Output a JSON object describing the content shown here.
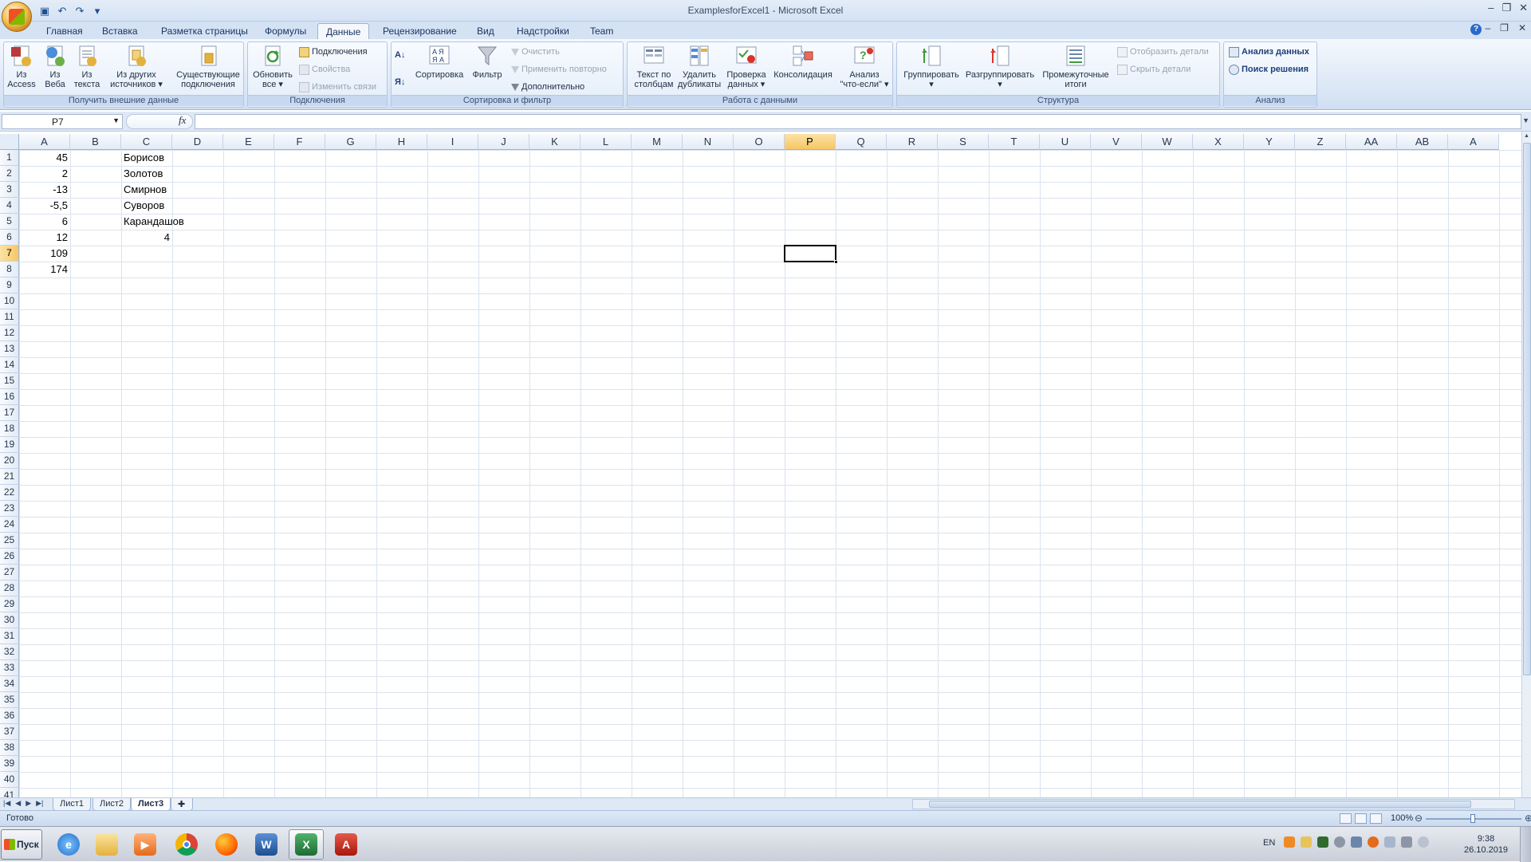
{
  "window": {
    "title": "ExamplesforExcel1 - Microsoft Excel"
  },
  "qat": {
    "icons": [
      "save-icon",
      "undo-icon",
      "redo-icon",
      "customize-icon"
    ]
  },
  "tabs": [
    {
      "label": "Главная"
    },
    {
      "label": "Вставка"
    },
    {
      "label": "Разметка страницы"
    },
    {
      "label": "Формулы"
    },
    {
      "label": "Данные",
      "active": true
    },
    {
      "label": "Рецензирование"
    },
    {
      "label": "Вид"
    },
    {
      "label": "Надстройки"
    },
    {
      "label": "Team"
    }
  ],
  "ribbon": {
    "groups": {
      "external": "Получить внешние данные",
      "connections": "Подключения",
      "sortfilter": "Сортировка и фильтр",
      "datatools": "Работа с данными",
      "outline": "Структура",
      "analysis": "Анализ"
    },
    "external": {
      "access": [
        "Из",
        "Access"
      ],
      "web": [
        "Из",
        "Веба"
      ],
      "text": [
        "Из",
        "текста"
      ],
      "other": [
        "Из других",
        "источников ▾"
      ],
      "existing": [
        "Существующие",
        "подключения"
      ]
    },
    "connections": {
      "refresh": [
        "Обновить",
        "все ▾"
      ],
      "conn": "Подключения",
      "props": "Свойства",
      "edit_links": "Изменить связи"
    },
    "sortfilter": {
      "sort": "Сортировка",
      "filter": "Фильтр",
      "clear": "Очистить",
      "reapply": "Применить повторно",
      "advanced": "Дополнительно"
    },
    "datatools": {
      "text_to_cols": [
        "Текст по",
        "столбцам"
      ],
      "remove_dup": [
        "Удалить",
        "дубликаты"
      ],
      "validation": [
        "Проверка",
        "данных ▾"
      ],
      "consolidate": "Консолидация",
      "whatif": [
        "Анализ",
        "\"что-если\" ▾"
      ]
    },
    "outline": {
      "group": [
        "Группировать",
        "▾"
      ],
      "ungroup": [
        "Разгруппировать",
        "▾"
      ],
      "subtotal": [
        "Промежуточные",
        "итоги"
      ],
      "show": "Отобразить детали",
      "hide": "Скрыть детали"
    },
    "analysis": {
      "data_analysis": "Анализ данных",
      "solver": "Поиск решения"
    }
  },
  "formula_bar": {
    "name_box": "P7",
    "fx": "fx",
    "formula": ""
  },
  "columns": [
    "A",
    "B",
    "C",
    "D",
    "E",
    "F",
    "G",
    "H",
    "I",
    "J",
    "K",
    "L",
    "M",
    "N",
    "O",
    "P",
    "Q",
    "R",
    "S",
    "T",
    "U",
    "V",
    "W",
    "X",
    "Y",
    "Z",
    "AA",
    "AB",
    "A"
  ],
  "selected_column": "P",
  "selected_row": 7,
  "row_count": 41,
  "cells": {
    "A1": "45",
    "A2": "2",
    "A3": "-13",
    "A4": "-5,5",
    "A5": "6",
    "A6": "12",
    "A7": "109",
    "A8": "174",
    "C1": "Борисов",
    "C2": "Золотов",
    "C3": "Смирнов",
    "C4": "Суворов",
    "C5": "Карандашов",
    "C6": "4"
  },
  "sheets": [
    {
      "label": "Лист1"
    },
    {
      "label": "Лист2"
    },
    {
      "label": "Лист3",
      "active": true
    }
  ],
  "status": {
    "text": "Готово",
    "zoom": "100%",
    "zoom_level_percent": 100
  },
  "taskbar": {
    "start": "Пуск",
    "apps": [
      "ie-icon",
      "explorer-icon",
      "media-player-icon",
      "chrome-icon",
      "firefox-icon",
      "word-icon",
      "excel-icon",
      "acrobat-icon"
    ],
    "lang": "EN",
    "time": "9:38",
    "date": "26.10.2019"
  },
  "colors": {
    "accent": "#d4e2f4",
    "selected_header": "#f6c664"
  }
}
